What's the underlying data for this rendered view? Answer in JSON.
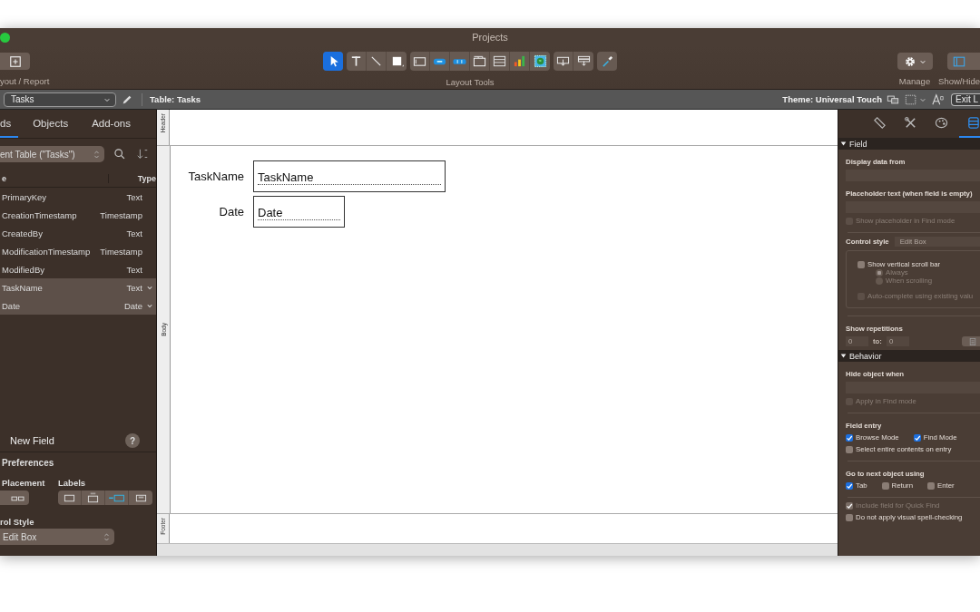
{
  "window": {
    "title": "Projects"
  },
  "toolbar": {
    "left_label": "yout / Report",
    "tools_label": "Layout Tools",
    "manage_label": "Manage",
    "show_hide_label": "Show/Hide",
    "tool_groups": [
      {
        "tools": [
          {
            "kind": "pointer",
            "selected": true
          }
        ]
      },
      {
        "tools": [
          {
            "kind": "text",
            "selected": false
          },
          {
            "kind": "line",
            "selected": false
          },
          {
            "kind": "shape",
            "selected": false
          }
        ]
      },
      {
        "tools": [
          {
            "kind": "field",
            "selected": false
          },
          {
            "kind": "button",
            "selected": false
          },
          {
            "kind": "button-bar",
            "selected": false
          },
          {
            "kind": "tab-control",
            "selected": false
          },
          {
            "kind": "portal",
            "selected": false
          },
          {
            "kind": "chart",
            "selected": false
          },
          {
            "kind": "web-viewer",
            "selected": false
          }
        ]
      },
      {
        "tools": [
          {
            "kind": "insert-field",
            "selected": false
          },
          {
            "kind": "insert-part",
            "selected": false
          }
        ]
      },
      {
        "tools": [
          {
            "kind": "painter",
            "selected": false
          }
        ]
      }
    ]
  },
  "layout_bar": {
    "layout": "Tasks",
    "table": "Table: Tasks",
    "theme": "Theme: Universal Touch",
    "exit": "Exit L"
  },
  "fields_panel": {
    "tabs": [
      {
        "label": "ds",
        "selected": true
      },
      {
        "label": "Objects",
        "selected": false
      },
      {
        "label": "Add-ons",
        "selected": false
      }
    ],
    "table_select": "ent Table (\"Tasks\")",
    "columns": [
      "e",
      "Type"
    ],
    "fields": [
      {
        "name": "PrimaryKey",
        "type": "Text",
        "selected": false
      },
      {
        "name": "CreationTimestamp",
        "type": "Timestamp",
        "selected": false
      },
      {
        "name": "CreatedBy",
        "type": "Text",
        "selected": false
      },
      {
        "name": "ModificationTimestamp",
        "type": "Timestamp",
        "selected": false
      },
      {
        "name": "ModifiedBy",
        "type": "Text",
        "selected": false
      },
      {
        "name": "TaskName",
        "type": "Text",
        "selected": true
      },
      {
        "name": "Date",
        "type": "Date",
        "selected": true
      }
    ],
    "new_field": "New Field",
    "help": "?",
    "preferences": {
      "title": "Preferences",
      "placement_label": "Placement",
      "labels_label": "Labels",
      "placement_options": [
        {
          "selected": false
        }
      ],
      "label_options": [
        {
          "selected": false
        },
        {
          "selected": false
        },
        {
          "selected": true
        },
        {
          "selected": false
        }
      ],
      "control_style_label": "rol Style",
      "control_style": "Edit Box"
    }
  },
  "canvas": {
    "parts": [
      {
        "label": "Header"
      },
      {
        "label": "Body"
      },
      {
        "label": "Footer"
      }
    ],
    "objects": [
      {
        "label": "TaskName",
        "field": "TaskName"
      },
      {
        "label": "Date",
        "field": "Date"
      }
    ]
  },
  "inspector": {
    "tabs": [
      {
        "kind": "ruler",
        "selected": false
      },
      {
        "kind": "tools",
        "selected": false
      },
      {
        "kind": "palette",
        "selected": false
      },
      {
        "kind": "data",
        "selected": true
      }
    ],
    "sections": [
      {
        "title": "Field",
        "expanded": true,
        "items": [
          {
            "kind": "heading",
            "text": "Display data from"
          },
          {
            "kind": "input"
          },
          {
            "kind": "heading",
            "text": "Placeholder text (when field is empty)"
          },
          {
            "kind": "input"
          },
          {
            "kind": "checks",
            "options": [
              {
                "label": "Show placeholder in Find mode",
                "checked": false,
                "disabled": true
              }
            ]
          },
          {
            "kind": "divider"
          },
          {
            "kind": "select",
            "label": "Control style",
            "value": "Edit Box"
          },
          {
            "kind": "group",
            "items": [
              {
                "kind": "checks",
                "options": [
                  {
                    "label": "Show vertical scroll bar",
                    "checked": false,
                    "disabled": false
                  }
                ]
              },
              {
                "kind": "radio",
                "label": "Always",
                "selected": true
              },
              {
                "kind": "radio",
                "label": "When scrolling",
                "selected": false
              },
              {
                "kind": "checks",
                "options": [
                  {
                    "label": "Auto-complete using existing valu",
                    "checked": false,
                    "disabled": true
                  }
                ]
              }
            ]
          },
          {
            "kind": "divider"
          },
          {
            "kind": "heading",
            "text": "Show repetitions"
          },
          {
            "kind": "repetitions",
            "from": "0",
            "to_label": "to:",
            "to": "0"
          }
        ]
      },
      {
        "title": "Behavior",
        "expanded": true,
        "items": [
          {
            "kind": "heading",
            "text": "Hide object when"
          },
          {
            "kind": "input"
          },
          {
            "kind": "checks",
            "options": [
              {
                "label": "Apply in Find mode",
                "checked": false,
                "disabled": true
              }
            ]
          },
          {
            "kind": "divider"
          },
          {
            "kind": "heading",
            "text": "Field entry"
          },
          {
            "kind": "checks",
            "options": [
              {
                "label": "Browse Mode",
                "checked": true,
                "disabled": false
              },
              {
                "label": "Find Mode",
                "checked": true,
                "disabled": false
              }
            ]
          },
          {
            "kind": "checks",
            "options": [
              {
                "label": "Select entire contents on entry",
                "checked": false,
                "disabled": false
              }
            ]
          },
          {
            "kind": "divider"
          },
          {
            "kind": "heading",
            "text": "Go to next object using"
          },
          {
            "kind": "checks",
            "options": [
              {
                "label": "Tab",
                "checked": true,
                "disabled": false
              },
              {
                "label": "Return",
                "checked": false,
                "disabled": false
              },
              {
                "label": "Enter",
                "checked": false,
                "disabled": false
              }
            ]
          },
          {
            "kind": "divider"
          },
          {
            "kind": "checks",
            "options": [
              {
                "label": "Include field for Quick Find",
                "checked": true,
                "disabled": true
              }
            ]
          },
          {
            "kind": "checks",
            "options": [
              {
                "label": "Do not apply visual spell-checking",
                "checked": false,
                "disabled": false
              }
            ]
          }
        ]
      }
    ]
  }
}
